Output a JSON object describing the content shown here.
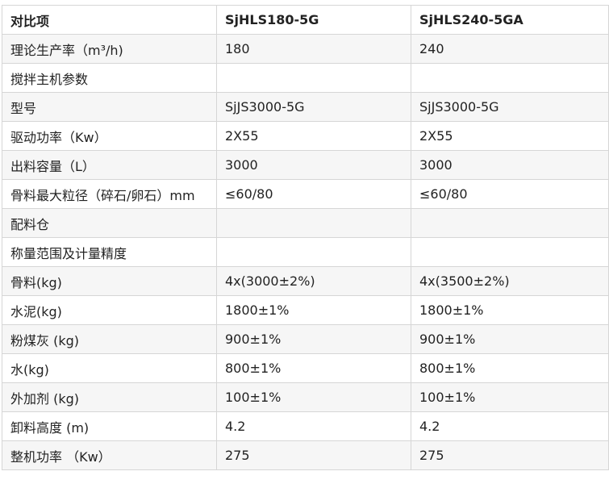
{
  "table": {
    "headers": [
      "对比项",
      "SjHLS180-5G",
      "SjHLS240-5GA"
    ],
    "rows": [
      [
        "理论生产率（m³/h)",
        "180",
        "240"
      ],
      [
        "搅拌主机参数",
        "",
        ""
      ],
      [
        "型号",
        "SjJS3000-5G",
        "SjJS3000-5G"
      ],
      [
        "驱动功率（Kw）",
        "2X55",
        "2X55"
      ],
      [
        "出料容量（L）",
        "3000",
        "3000"
      ],
      [
        "骨料最大粒径（碎石/卵石）mm",
        "≤60/80",
        "≤60/80"
      ],
      [
        "配料仓",
        "",
        ""
      ],
      [
        "称量范围及计量精度",
        "",
        ""
      ],
      [
        "骨料(kg)",
        "4x(3000±2%)",
        "4x(3500±2%)"
      ],
      [
        "水泥(kg)",
        "1800±1%",
        "1800±1%"
      ],
      [
        "粉煤灰 (kg)",
        "900±1%",
        "900±1%"
      ],
      [
        "水(kg)",
        "800±1%",
        "800±1%"
      ],
      [
        "外加剂 (kg)",
        "100±1%",
        "100±1%"
      ],
      [
        "卸料高度 (m)",
        "4.2",
        "4.2"
      ],
      [
        "整机功率 （Kw）",
        "275",
        "275"
      ]
    ]
  }
}
